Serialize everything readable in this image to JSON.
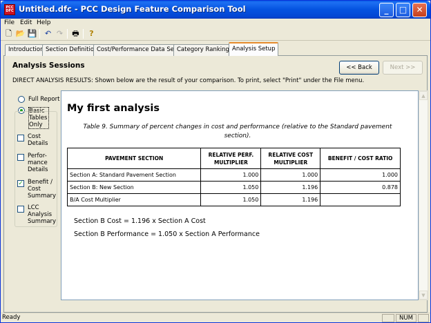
{
  "window": {
    "icon_text": "PCC DFC",
    "title": "Untitled.dfc - PCC Design Feature Comparison Tool",
    "minimize": "_",
    "maximize": "□",
    "close": "✕"
  },
  "menu": [
    "File",
    "Edit",
    "Help"
  ],
  "toolbar": [
    {
      "name": "new-file-icon",
      "glyph": "🗋"
    },
    {
      "name": "open-folder-icon",
      "glyph": "📂"
    },
    {
      "name": "save-icon",
      "glyph": "💾"
    },
    {
      "name": "undo-icon",
      "glyph": "↶"
    },
    {
      "name": "redo-icon",
      "glyph": "↷"
    },
    {
      "name": "print-icon",
      "glyph": "🖶"
    },
    {
      "name": "help-icon",
      "glyph": "?"
    }
  ],
  "tabs": [
    "Introduction",
    "Section Definition",
    "Cost/Performance Data Sets",
    "Category Rankings",
    "Analysis Setup"
  ],
  "panel": {
    "title": "Analysis Sessions",
    "back": "<< Back",
    "next": "Next >>",
    "instructions": "DIRECT ANALYSIS RESULTS:  Shown below are the result of your comparison.  To print, select \"Print\" under the File menu."
  },
  "options": {
    "full_report": "Full Report",
    "basic_tables": "Basic Tables Only",
    "cost_details": "Cost Details",
    "perf_details": "Perfor-mance Details",
    "benefit_cost": "Benefit / Cost Summary",
    "lcc": "LCC Analysis Summary",
    "checked": "✓"
  },
  "report": {
    "title": "My first analysis",
    "caption": "Table 9.  Summary of percent changes in cost and performance (relative to the Standard pavement section).",
    "headers": [
      "PAVEMENT SECTION",
      "RELATIVE PERF. MULTIPLIER",
      "RELATIVE COST MULTIPLIER",
      "BENEFIT / COST RATIO"
    ],
    "rows": [
      [
        "Section A: Standard Pavement Section",
        "1.000",
        "1.000",
        "1.000"
      ],
      [
        "Section B: New Section",
        "1.050",
        "1.196",
        "0.878"
      ],
      [
        "B/A Cost Multiplier",
        "1.050",
        "1.196",
        ""
      ]
    ],
    "eq1": "Section B Cost = 1.196 x Section A Cost",
    "eq2": "Section B Performance = 1.050 x Section A Performance"
  },
  "scrollbar": {
    "up": "▲",
    "down": "▼"
  },
  "status": {
    "text": "Ready",
    "num": "NUM"
  }
}
